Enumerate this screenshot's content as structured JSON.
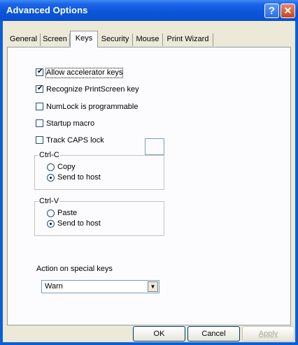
{
  "window": {
    "title": "Advanced Options",
    "help_glyph": "?",
    "close_glyph": "✕"
  },
  "tabs": [
    {
      "label": "General"
    },
    {
      "label": "Screen"
    },
    {
      "label": "Keys"
    },
    {
      "label": "Security"
    },
    {
      "label": "Mouse"
    },
    {
      "label": "Print Wizard"
    }
  ],
  "active_tab": "Keys",
  "checkboxes": [
    {
      "label": "Allow accelerator keys",
      "checked": true
    },
    {
      "label": "Recognize PrintScreen key",
      "checked": true
    },
    {
      "label": "NumLock is programmable",
      "checked": false
    },
    {
      "label": "Startup macro",
      "checked": false
    },
    {
      "label": "Track CAPS lock",
      "checked": false
    }
  ],
  "groups": {
    "ctrl_c": {
      "label": "Ctrl-C",
      "options": [
        "Copy",
        "Send to host"
      ],
      "selected": "Send to host"
    },
    "ctrl_v": {
      "label": "Ctrl-V",
      "options": [
        "Paste",
        "Send to host"
      ],
      "selected": "Send to host"
    }
  },
  "special_keys": {
    "label": "Action on special keys",
    "value": "Warn"
  },
  "buttons": {
    "ok": "OK",
    "cancel": "Cancel",
    "apply": "Apply"
  },
  "check_glyph": "✔"
}
